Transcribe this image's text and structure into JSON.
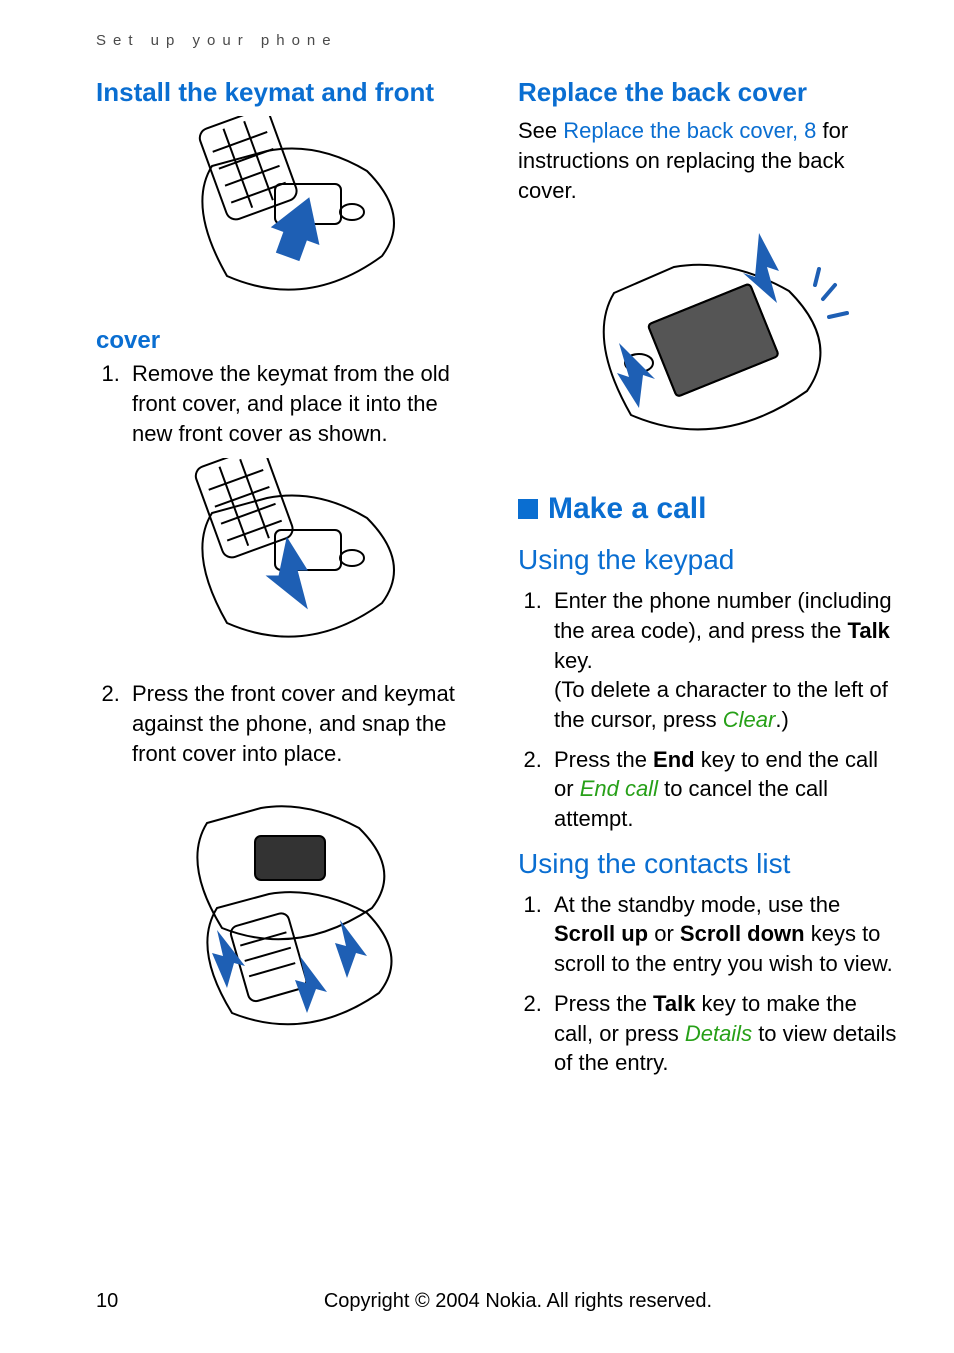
{
  "running_head": "Set up your phone",
  "left": {
    "heading1": "Install the keymat and front",
    "heading1b": "cover",
    "step1": "Remove the keymat from the old front cover, and place it into the new front cover as shown.",
    "step2": "Press the front cover and keymat against the phone, and snap the front cover into place."
  },
  "right": {
    "heading1": "Replace the back cover",
    "intro_a": "See ",
    "intro_link": "Replace the back cover, 8",
    "intro_b": " for instructions on replacing the back cover.",
    "section_heading": "Make a call",
    "sub1": "Using the keypad",
    "sub1_step1_a": "Enter the phone number (including the area code), and press the ",
    "sub1_step1_key": "Talk",
    "sub1_step1_b": " key.",
    "sub1_step1_par_a": "(To delete a character to the left of the cursor, press ",
    "sub1_step1_soft": "Clear",
    "sub1_step1_par_b": ".)",
    "sub1_step2_a": "Press the ",
    "sub1_step2_key": "End",
    "sub1_step2_b": " key to end the call or ",
    "sub1_step2_soft": "End call",
    "sub1_step2_c": " to cancel the call attempt.",
    "sub2": "Using the contacts list",
    "sub2_step1_a": "At the standby mode, use the ",
    "sub2_step1_key1": "Scroll up",
    "sub2_step1_mid": " or ",
    "sub2_step1_key2": "Scroll down",
    "sub2_step1_b": " keys to scroll to the entry you wish to view.",
    "sub2_step2_a": "Press the ",
    "sub2_step2_key": "Talk",
    "sub2_step2_b": " key to make the call, or press ",
    "sub2_step2_soft": "Details",
    "sub2_step2_c": " to view details of the entry."
  },
  "footer": {
    "page": "10",
    "copyright": "Copyright © 2004 Nokia. All rights reserved."
  }
}
